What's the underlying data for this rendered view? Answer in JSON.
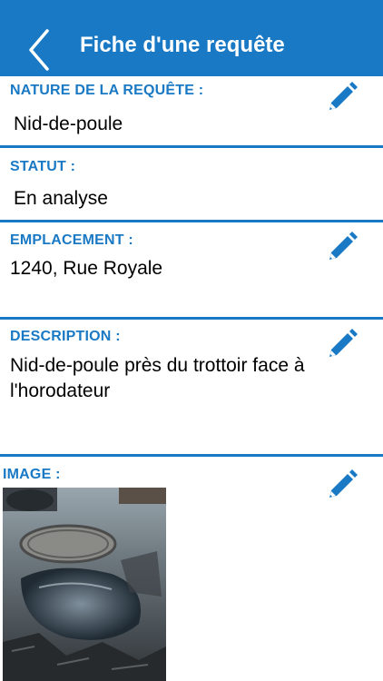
{
  "header": {
    "title": "Fiche d'une requête"
  },
  "fields": {
    "nature": {
      "label": "NATURE DE LA REQUÊTE :",
      "value": "Nid-de-poule"
    },
    "statut": {
      "label": "STATUT :",
      "value": "En analyse"
    },
    "emplacement": {
      "label": "EMPLACEMENT :",
      "value": "1240, Rue Royale"
    },
    "description": {
      "label": "DESCRIPTION :",
      "value": "Nid-de-poule près du trottoir face à l'horodateur"
    },
    "image": {
      "label": "IMAGE :"
    }
  },
  "colors": {
    "accent": "#1a79c4",
    "text": "#000000",
    "background": "#ffffff"
  },
  "icons": {
    "back": "chevron-left-icon",
    "edit": "pencil-icon"
  }
}
